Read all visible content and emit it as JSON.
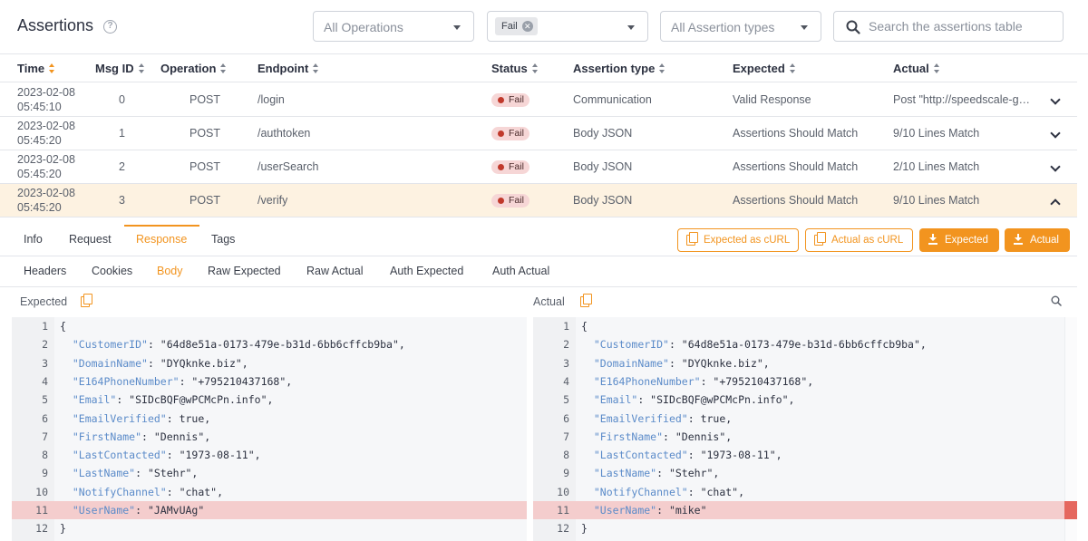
{
  "header": {
    "title": "Assertions",
    "help_icon": "help-circle-icon",
    "operations_placeholder": "All Operations",
    "status_chip": "Fail",
    "assertion_types_placeholder": "All Assertion types",
    "search_placeholder": "Search the assertions table"
  },
  "table": {
    "columns": [
      "Time",
      "Msg ID",
      "Operation",
      "Endpoint",
      "Status",
      "Assertion type",
      "Expected",
      "Actual"
    ],
    "rows": [
      {
        "time": "2023-02-08 05:45:10",
        "msg_id": "0",
        "operation": "POST",
        "endpoint": "/login",
        "status": "Fail",
        "assertion_type": "Communication",
        "expected": "Valid Response",
        "actual": "Post \"http://speedscale-g…"
      },
      {
        "time": "2023-02-08 05:45:20",
        "msg_id": "1",
        "operation": "POST",
        "endpoint": "/authtoken",
        "status": "Fail",
        "assertion_type": "Body JSON",
        "expected": "Assertions Should Match",
        "actual": "9/10 Lines Match"
      },
      {
        "time": "2023-02-08 05:45:20",
        "msg_id": "2",
        "operation": "POST",
        "endpoint": "/userSearch",
        "status": "Fail",
        "assertion_type": "Body JSON",
        "expected": "Assertions Should Match",
        "actual": "2/10 Lines Match"
      },
      {
        "time": "2023-02-08 05:45:20",
        "msg_id": "3",
        "operation": "POST",
        "endpoint": "/verify",
        "status": "Fail",
        "assertion_type": "Body JSON",
        "expected": "Assertions Should Match",
        "actual": "9/10 Lines Match"
      }
    ]
  },
  "detail": {
    "tabs": [
      "Info",
      "Request",
      "Response",
      "Tags"
    ],
    "active_tab": "Response",
    "buttons": {
      "expected_curl": "Expected as cURL",
      "actual_curl": "Actual as cURL",
      "download_expected": "Expected",
      "download_actual": "Actual"
    },
    "subtabs": [
      "Headers",
      "Cookies",
      "Body",
      "Raw Expected",
      "Raw Actual",
      "Auth Expected",
      "Auth Actual"
    ],
    "active_subtab": "Body"
  },
  "diff": {
    "expected_label": "Expected",
    "actual_label": "Actual",
    "highlight_line": 11,
    "expected_lines": [
      [
        {
          "t": "{",
          "c": "v"
        }
      ],
      [
        {
          "t": "  ",
          "c": "v"
        },
        {
          "t": "\"CustomerID\"",
          "c": "k"
        },
        {
          "t": ": \"64d8e51a-0173-479e-b31d-6bb6cffcb9ba\",",
          "c": "v"
        }
      ],
      [
        {
          "t": "  ",
          "c": "v"
        },
        {
          "t": "\"DomainName\"",
          "c": "k"
        },
        {
          "t": ": \"DYQknke.biz\",",
          "c": "v"
        }
      ],
      [
        {
          "t": "  ",
          "c": "v"
        },
        {
          "t": "\"E164PhoneNumber\"",
          "c": "k"
        },
        {
          "t": ": \"+795210437168\",",
          "c": "v"
        }
      ],
      [
        {
          "t": "  ",
          "c": "v"
        },
        {
          "t": "\"Email\"",
          "c": "k"
        },
        {
          "t": ": \"SIDcBQF@wPCMcPn.info\",",
          "c": "v"
        }
      ],
      [
        {
          "t": "  ",
          "c": "v"
        },
        {
          "t": "\"EmailVerified\"",
          "c": "k"
        },
        {
          "t": ": true,",
          "c": "v"
        }
      ],
      [
        {
          "t": "  ",
          "c": "v"
        },
        {
          "t": "\"FirstName\"",
          "c": "k"
        },
        {
          "t": ": \"Dennis\",",
          "c": "v"
        }
      ],
      [
        {
          "t": "  ",
          "c": "v"
        },
        {
          "t": "\"LastContacted\"",
          "c": "k"
        },
        {
          "t": ": \"1973-08-11\",",
          "c": "v"
        }
      ],
      [
        {
          "t": "  ",
          "c": "v"
        },
        {
          "t": "\"LastName\"",
          "c": "k"
        },
        {
          "t": ": \"Stehr\",",
          "c": "v"
        }
      ],
      [
        {
          "t": "  ",
          "c": "v"
        },
        {
          "t": "\"NotifyChannel\"",
          "c": "k"
        },
        {
          "t": ": \"chat\",",
          "c": "v"
        }
      ],
      [
        {
          "t": "  ",
          "c": "v"
        },
        {
          "t": "\"UserName\"",
          "c": "k"
        },
        {
          "t": ": \"JAMvUAg\"",
          "c": "v"
        }
      ],
      [
        {
          "t": "}",
          "c": "v"
        }
      ]
    ],
    "actual_lines": [
      [
        {
          "t": "{",
          "c": "v"
        }
      ],
      [
        {
          "t": "  ",
          "c": "v"
        },
        {
          "t": "\"CustomerID\"",
          "c": "k"
        },
        {
          "t": ": \"64d8e51a-0173-479e-b31d-6bb6cffcb9ba\",",
          "c": "v"
        }
      ],
      [
        {
          "t": "  ",
          "c": "v"
        },
        {
          "t": "\"DomainName\"",
          "c": "k"
        },
        {
          "t": ": \"DYQknke.biz\",",
          "c": "v"
        }
      ],
      [
        {
          "t": "  ",
          "c": "v"
        },
        {
          "t": "\"E164PhoneNumber\"",
          "c": "k"
        },
        {
          "t": ": \"+795210437168\",",
          "c": "v"
        }
      ],
      [
        {
          "t": "  ",
          "c": "v"
        },
        {
          "t": "\"Email\"",
          "c": "k"
        },
        {
          "t": ": \"SIDcBQF@wPCMcPn.info\",",
          "c": "v"
        }
      ],
      [
        {
          "t": "  ",
          "c": "v"
        },
        {
          "t": "\"EmailVerified\"",
          "c": "k"
        },
        {
          "t": ": true,",
          "c": "v"
        }
      ],
      [
        {
          "t": "  ",
          "c": "v"
        },
        {
          "t": "\"FirstName\"",
          "c": "k"
        },
        {
          "t": ": \"Dennis\",",
          "c": "v"
        }
      ],
      [
        {
          "t": "  ",
          "c": "v"
        },
        {
          "t": "\"LastContacted\"",
          "c": "k"
        },
        {
          "t": ": \"1973-08-11\",",
          "c": "v"
        }
      ],
      [
        {
          "t": "  ",
          "c": "v"
        },
        {
          "t": "\"LastName\"",
          "c": "k"
        },
        {
          "t": ": \"Stehr\",",
          "c": "v"
        }
      ],
      [
        {
          "t": "  ",
          "c": "v"
        },
        {
          "t": "\"NotifyChannel\"",
          "c": "k"
        },
        {
          "t": ": \"chat\",",
          "c": "v"
        }
      ],
      [
        {
          "t": "  ",
          "c": "v"
        },
        {
          "t": "\"UserName\"",
          "c": "k"
        },
        {
          "t": ": \"mike\"",
          "c": "v"
        }
      ],
      [
        {
          "t": "}",
          "c": "v"
        }
      ]
    ]
  },
  "colors": {
    "accent": "#f2941f",
    "fail_badge_bg": "#f6d6d6",
    "fail_dot": "#c0392b",
    "selected_row_bg": "#fdf2e1",
    "diff_highlight": "#f4cdcd",
    "json_key": "#5b8bc9"
  }
}
